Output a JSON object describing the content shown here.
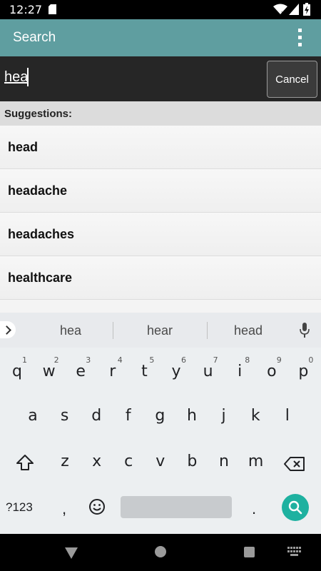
{
  "status_bar": {
    "time": "12:27"
  },
  "app_bar": {
    "title": "Search"
  },
  "search": {
    "query": "hea",
    "cancel_label": "Cancel"
  },
  "suggestions": {
    "header": "Suggestions:",
    "items": [
      "head",
      "headache",
      "headaches",
      "healthcare"
    ]
  },
  "keyboard": {
    "strip_words": [
      "hea",
      "hear",
      "head"
    ],
    "row1": [
      {
        "ch": "q",
        "num": "1"
      },
      {
        "ch": "w",
        "num": "2"
      },
      {
        "ch": "e",
        "num": "3"
      },
      {
        "ch": "r",
        "num": "4"
      },
      {
        "ch": "t",
        "num": "5"
      },
      {
        "ch": "y",
        "num": "6"
      },
      {
        "ch": "u",
        "num": "7"
      },
      {
        "ch": "i",
        "num": "8"
      },
      {
        "ch": "o",
        "num": "9"
      },
      {
        "ch": "p",
        "num": "0"
      }
    ],
    "row2": [
      "a",
      "s",
      "d",
      "f",
      "g",
      "h",
      "j",
      "k",
      "l"
    ],
    "row3": [
      "z",
      "x",
      "c",
      "v",
      "b",
      "n",
      "m"
    ],
    "symbols_label": "?123",
    "comma": ",",
    "period": "."
  },
  "colors": {
    "app_bar": "#5f9ea0",
    "search_bar": "#262626",
    "search_key": "#1eb1a0"
  }
}
